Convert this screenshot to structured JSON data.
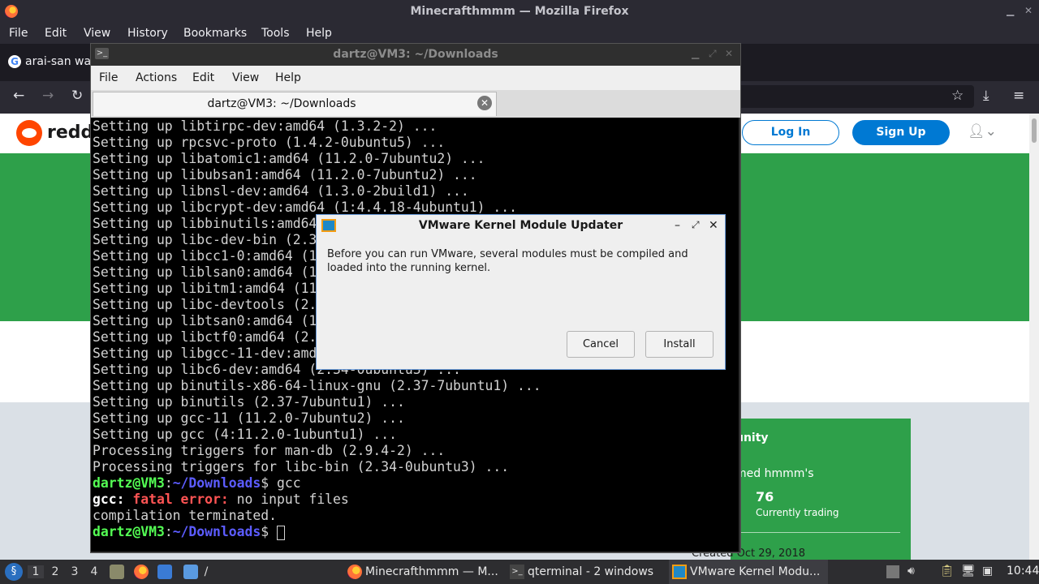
{
  "firefox": {
    "window_title": "Minecrafthmmm — Mozilla Firefox",
    "menu": [
      "File",
      "Edit",
      "View",
      "History",
      "Bookmarks",
      "Tools",
      "Help"
    ],
    "tab_title": "arai-san wa",
    "tab_favicon_letter": "G"
  },
  "reddit": {
    "wordmark": "reddi",
    "login_label": "Log In",
    "signup_label": "Sign Up",
    "sidebar": {
      "title": "unity",
      "named": "med hmmm's",
      "count": "76",
      "count_label": "Currently trading",
      "created": "Created Oct 29, 2018"
    },
    "colors": {
      "banner": "#2ea04a",
      "button": "#0079d3"
    }
  },
  "qterminal": {
    "window_title": "dartz@VM3: ~/Downloads",
    "menu": [
      "File",
      "Actions",
      "Edit",
      "View",
      "Help"
    ],
    "tab_label": "dartz@VM3: ~/Downloads",
    "lines": [
      "Setting up libtirpc-dev:amd64 (1.3.2-2) ...",
      "Setting up rpcsvc-proto (1.4.2-0ubuntu5) ...",
      "Setting up libatomic1:amd64 (11.2.0-7ubuntu2) ...",
      "Setting up libubsan1:amd64 (11.2.0-7ubuntu2) ...",
      "Setting up libnsl-dev:amd64 (1.3.0-2build1) ...",
      "Setting up libcrypt-dev:amd64 (1:4.4.18-4ubuntu1) ...",
      "Setting up libbinutils:amd64 (2.37-7ubuntu1) ...",
      "Setting up libc-dev-bin (2.34-0ubuntu3) ...",
      "Setting up libcc1-0:amd64 (11.2.0-7ubuntu2) ...",
      "Setting up liblsan0:amd64 (11.2.0-7ubuntu2) ...",
      "Setting up libitm1:amd64 (11.2.0-7ubuntu2) ...",
      "Setting up libc-devtools (2.34-0ubuntu3) ...",
      "Setting up libtsan0:amd64 (11.2.0-7ubuntu2) ...",
      "Setting up libctf0:amd64 (2.37-7ubuntu1) ...",
      "Setting up libgcc-11-dev:amd64 (11.2.0-7ubuntu2) ...",
      "Setting up libc6-dev:amd64 (2.34-0ubuntu3) ...",
      "Setting up binutils-x86-64-linux-gnu (2.37-7ubuntu1) ...",
      "Setting up binutils (2.37-7ubuntu1) ...",
      "Setting up gcc-11 (11.2.0-7ubuntu2) ...",
      "Setting up gcc (4:11.2.0-1ubuntu1) ...",
      "Processing triggers for man-db (2.9.4-2) ...",
      "Processing triggers for libc-bin (2.34-0ubuntu3) ..."
    ],
    "prompt_user": "dartz@VM3",
    "prompt_sep": ":",
    "prompt_path": "~/Downloads",
    "prompt_end": "$ ",
    "command": "gcc",
    "error_prefix": "gcc: ",
    "error_label": "fatal error:",
    "error_text": " no input files",
    "error_line2": "compilation terminated."
  },
  "vmware_dialog": {
    "title": "VMware Kernel Module Updater",
    "message": "Before you can run VMware, several modules must be compiled and loaded into the running kernel.",
    "cancel_label": "Cancel",
    "install_label": "Install"
  },
  "taskbar": {
    "workspaces": [
      "1",
      "2",
      "3",
      "4"
    ],
    "file_path_label": "/",
    "tasks": [
      {
        "label": "Minecrafthmmm — M...",
        "icon": "firefox-icon"
      },
      {
        "label": "qterminal - 2 windows",
        "icon": "terminal-icon"
      },
      {
        "label": "VMware Kernel Modu...",
        "icon": "vmware-icon"
      }
    ],
    "clock": "10:44"
  }
}
